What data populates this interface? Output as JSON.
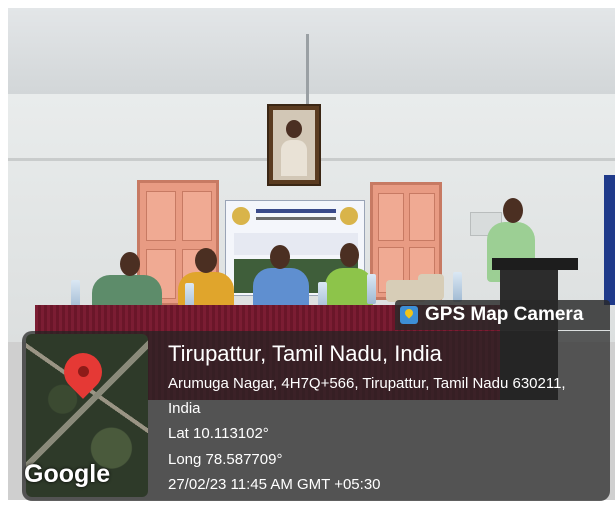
{
  "overlay": {
    "camera_label": "GPS Map Camera",
    "location_title": "Tirupattur, Tamil Nadu, India",
    "address_line1": "Arumuga Nagar, 4H7Q+566, Tirupattur, Tamil Nadu 630211,",
    "address_line2": "India",
    "latitude": "Lat 10.113102°",
    "longitude": "Long 78.587709°",
    "datetime": "27/02/23 11:45 AM GMT +05:30",
    "map_logo": "Google"
  },
  "colors": {
    "pin": "#e53935",
    "door": "#e89b83",
    "tablecloth": "#7b1d33"
  }
}
